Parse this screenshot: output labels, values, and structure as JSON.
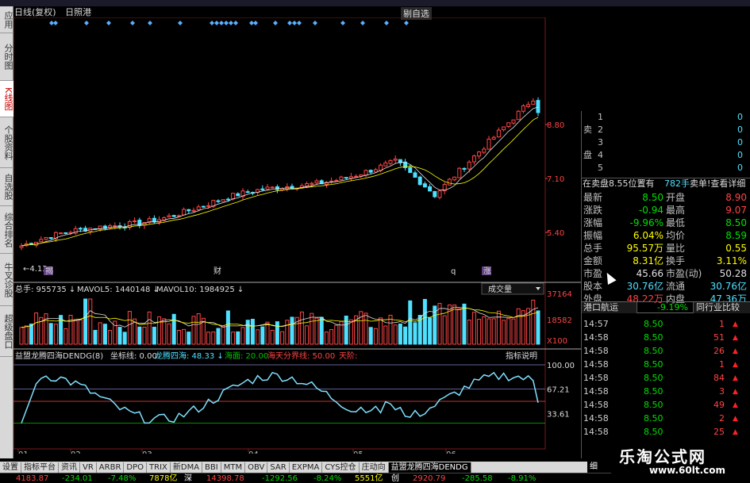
{
  "header": {
    "title": "日线(复权)",
    "subtitle": "日照港",
    "corner": "剔自选"
  },
  "left_tabs": [
    {
      "label": "应用",
      "active": false
    },
    {
      "label": "分时图",
      "active": false
    },
    {
      "label": "K线图",
      "active": true
    },
    {
      "label": "个股资料",
      "active": false
    },
    {
      "label": "自选股",
      "active": false
    },
    {
      "label": "综合排名",
      "active": false
    },
    {
      "label": "牛叉诊股",
      "active": false
    },
    {
      "label": "超级盘口",
      "active": false
    }
  ],
  "price_chart": {
    "axis_labels": [
      "8.80",
      "7.10",
      "5.40"
    ],
    "low_label": "←4.13",
    "markers": [
      "揭",
      "财",
      "q",
      "涨"
    ]
  },
  "volume_panel": {
    "header": {
      "total": "总手: 955735",
      "ma5": "MAVOL5: 1440148",
      "ma10": "MAVOL10: 1984925"
    },
    "dropdown": "成交量",
    "axis_labels": [
      "37164",
      "18582",
      "X100"
    ]
  },
  "indicator_panel": {
    "header": {
      "name": "益盟龙腾四海DENDG(8)",
      "coord": "坐标线: 0.00",
      "ltsh": "龙腾四海: 48.33",
      "haimian": "海面: 20.00",
      "haitian": "海天分界线: 50.00",
      "tianjie": "天阶:"
    },
    "button": "指标说明",
    "axis_labels": [
      "100.00",
      "67.21",
      "33.61"
    ]
  },
  "x_axis_labels": [
    "01",
    "02",
    "03",
    "04",
    "05",
    "06"
  ],
  "bid_ask": [
    {
      "side": "",
      "num": "1",
      "vol": "0"
    },
    {
      "side": "卖",
      "num": "2",
      "vol": "0"
    },
    {
      "side": "",
      "num": "3",
      "vol": "0"
    },
    {
      "side": "盘",
      "num": "4",
      "vol": "0"
    },
    {
      "side": "",
      "num": "5",
      "vol": "0"
    }
  ],
  "sell_bar": {
    "text": "在卖盘8.55位置有",
    "vol": "782手",
    "button": "卖单!查看详细"
  },
  "quote": [
    {
      "l1": "最新",
      "v1": "8.50",
      "c1": "green",
      "l2": "开盘",
      "v2": "8.90",
      "c2": "red"
    },
    {
      "l1": "涨跌",
      "v1": "-0.94",
      "c1": "green",
      "l2": "最高",
      "v2": "9.07",
      "c2": "red"
    },
    {
      "l1": "涨幅",
      "v1": "-9.96%",
      "c1": "green",
      "l2": "最低",
      "v2": "8.50",
      "c2": "green"
    },
    {
      "l1": "振幅",
      "v1": "6.04%",
      "c1": "yellow",
      "l2": "均价",
      "v2": "8.59",
      "c2": "green"
    },
    {
      "l1": "总手",
      "v1": "95.57万",
      "c1": "yellow",
      "l2": "量比",
      "v2": "0.55",
      "c2": "yellow"
    },
    {
      "l1": "金额",
      "v1": "8.31亿",
      "c1": "yellow",
      "l2": "换手",
      "v2": "3.11%",
      "c2": "yellow"
    },
    {
      "l1": "市盈",
      "v1": "45.66",
      "c1": "white",
      "l2": "市盈(动)",
      "v2": "50.28",
      "c2": "white"
    },
    {
      "l1": "股本",
      "v1": "30.76亿",
      "c1": "cyan",
      "l2": "流通",
      "v2": "30.76亿",
      "c2": "cyan"
    },
    {
      "l1": "外盘",
      "v1": "48.22万",
      "c1": "red",
      "l2": "内盘",
      "v2": "47.36万",
      "c2": "cyan"
    }
  ],
  "right_tabs": {
    "stock": "港口航运",
    "pct": "-9.19%",
    "compare": "同行业比较"
  },
  "ticks": [
    {
      "time": "14:57",
      "price": "8.50",
      "vol": "1"
    },
    {
      "time": "14:58",
      "price": "8.50",
      "vol": "51"
    },
    {
      "time": "14:58",
      "price": "8.50",
      "vol": "26"
    },
    {
      "time": "14:58",
      "price": "8.50",
      "vol": "1"
    },
    {
      "time": "14:58",
      "price": "8.50",
      "vol": "84"
    },
    {
      "time": "14:58",
      "price": "8.50",
      "vol": "3"
    },
    {
      "time": "14:58",
      "price": "8.50",
      "vol": "49"
    },
    {
      "time": "14:58",
      "price": "8.50",
      "vol": "2"
    },
    {
      "time": "14:58",
      "price": "8.50",
      "vol": "25"
    }
  ],
  "bottom_tabs": [
    {
      "label": "设置",
      "active": false
    },
    {
      "label": "指标平台",
      "active": false
    },
    {
      "label": "资讯",
      "active": false
    },
    {
      "label": "VR",
      "active": false
    },
    {
      "label": "ARBR",
      "active": false
    },
    {
      "label": "DPO",
      "active": false
    },
    {
      "label": "TRIX",
      "active": false
    },
    {
      "label": "新DMA",
      "active": false
    },
    {
      "label": "BBI",
      "active": false
    },
    {
      "label": "MTM",
      "active": false
    },
    {
      "label": "OBV",
      "active": false
    },
    {
      "label": "SAR",
      "active": false
    },
    {
      "label": "EXPMA",
      "active": false
    },
    {
      "label": "CYS控仓",
      "active": false
    },
    {
      "label": "庄动向",
      "active": false
    },
    {
      "label": "益盟龙腾四海DENDG",
      "active": true
    }
  ],
  "bottom_right_tab": "细",
  "status_bar": [
    {
      "text": "4183.87",
      "color": "#ff4444"
    },
    {
      "text": "-234.01",
      "color": "#00e000"
    },
    {
      "text": "-7.48%",
      "color": "#00e000"
    },
    {
      "text": "7878亿",
      "color": "#ffff00"
    },
    {
      "text": "深",
      "color": "#ffffff"
    },
    {
      "text": "14398.78",
      "color": "#ff4444"
    },
    {
      "text": "-1292.56",
      "color": "#00e000"
    },
    {
      "text": "-8.24%",
      "color": "#00e000"
    },
    {
      "text": "5551亿",
      "color": "#ffff00"
    },
    {
      "text": "创",
      "color": "#ffffff"
    },
    {
      "text": "2920.79",
      "color": "#ff4444"
    },
    {
      "text": "-285.58",
      "color": "#00e000"
    },
    {
      "text": "-8.91%",
      "color": "#00e000"
    }
  ],
  "watermark": {
    "line1": "乐淘公式网",
    "line2": "www.60lt.com"
  },
  "colors": {
    "up": "#ff4444",
    "down": "#4fe0ff",
    "ma1": "#e0e0e0",
    "ma2": "#ffff00",
    "indicator": "#80e0ff",
    "grid": "#802020"
  }
}
